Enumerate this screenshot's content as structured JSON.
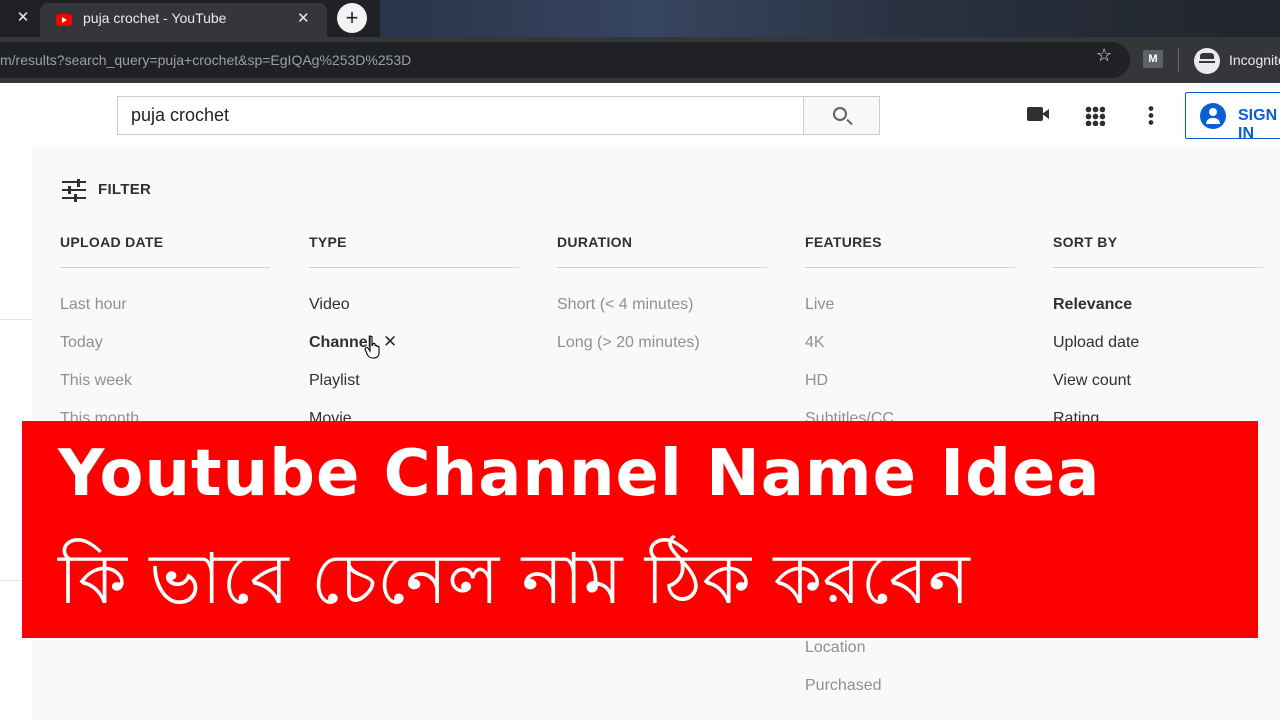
{
  "browser": {
    "tab_title": "puja crochet - YouTube",
    "new_tab_label": "+",
    "close_label": "✕",
    "url_prefix": "m/results?search_query=puja+crochet&sp=EgIQAg%253D%253D",
    "profile_label": "Incognito",
    "extension_label": "M"
  },
  "youtube": {
    "search_value": "puja crochet",
    "signin_label": "SIGN IN"
  },
  "filter": {
    "title": "FILTER",
    "columns": [
      {
        "heading": "UPLOAD DATE",
        "options": [
          "Last hour",
          "Today",
          "This week",
          "This month"
        ]
      },
      {
        "heading": "TYPE",
        "options": [
          "Video",
          "Channel",
          "Playlist",
          "Movie"
        ]
      },
      {
        "heading": "DURATION",
        "options": [
          "Short (< 4 minutes)",
          "Long (> 20 minutes)"
        ]
      },
      {
        "heading": "FEATURES",
        "options": [
          "Live",
          "4K",
          "HD",
          "Subtitles/CC",
          "Location",
          "Purchased"
        ]
      },
      {
        "heading": "SORT BY",
        "options": [
          "Relevance",
          "Upload date",
          "View count",
          "Rating"
        ]
      }
    ],
    "remove_label": "✕"
  },
  "banner": {
    "line1": "Youtube Channel Name Idea",
    "line2": "কি ভাবে চেনেল নাম ঠিক করবেন",
    "color": "#fe0000"
  }
}
